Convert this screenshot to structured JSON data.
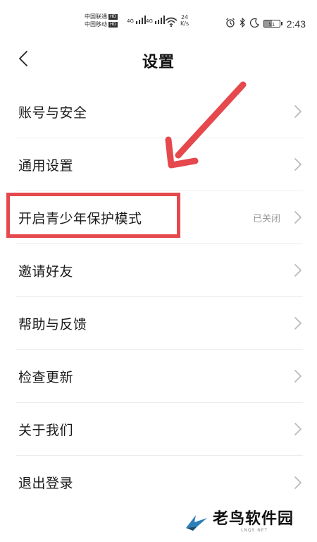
{
  "status_bar": {
    "carrier_1": "中国联通",
    "carrier_1_tag": "HD",
    "carrier_2": "中国移动",
    "carrier_2_tag": "HD",
    "network_1": "4G",
    "network_2": "4G",
    "speed_value": "24",
    "speed_unit": "K/s",
    "battery_level": "51",
    "battery_fraction": 0.51,
    "time": "2:43",
    "icons": [
      "alarm-icon",
      "bluetooth-icon",
      "moon-icon",
      "battery-icon",
      "wifi-icon",
      "signal-icon"
    ]
  },
  "nav": {
    "title": "设置"
  },
  "settings": {
    "items": [
      {
        "label": "账号与安全"
      },
      {
        "label": "通用设置"
      },
      {
        "label": "开启青少年保护模式",
        "value": "已关闭"
      },
      {
        "label": "邀请好友"
      },
      {
        "label": "帮助与反馈"
      },
      {
        "label": "检查更新"
      },
      {
        "label": "关于我们"
      },
      {
        "label": "退出登录"
      }
    ]
  },
  "annotation": {
    "highlight_color": "#e5484d",
    "arrow_color": "#e5484d"
  },
  "watermark": {
    "name": "老鸟软件园",
    "sub": "LNQS.NET"
  },
  "colors": {
    "divider": "#ececec",
    "value_text": "#9a9a9a",
    "chevron": "#b8b8b8"
  }
}
